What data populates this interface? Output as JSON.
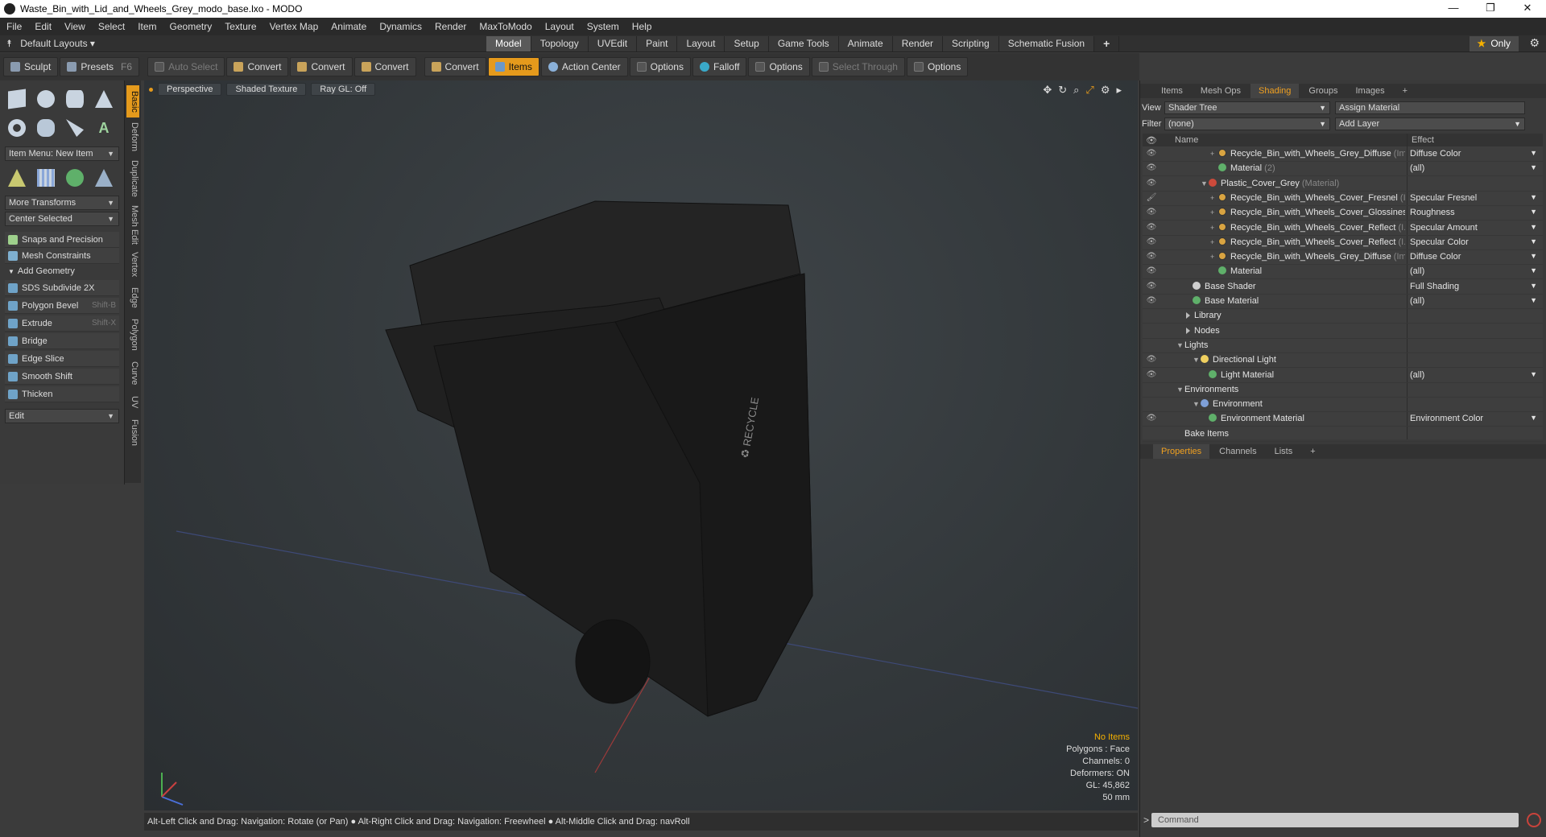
{
  "window": {
    "title": "Waste_Bin_with_Lid_and_Wheels_Grey_modo_base.lxo - MODO",
    "minimize": "—",
    "maximize": "❐",
    "close": "✕"
  },
  "menu": [
    "File",
    "Edit",
    "View",
    "Select",
    "Item",
    "Geometry",
    "Texture",
    "Vertex Map",
    "Animate",
    "Dynamics",
    "Render",
    "MaxToModo",
    "Layout",
    "System",
    "Help"
  ],
  "layout_bar": {
    "default_layouts": "Default Layouts",
    "tabs": [
      "Model",
      "Topology",
      "UVEdit",
      "Paint",
      "Layout",
      "Setup",
      "Game Tools",
      "Animate",
      "Render",
      "Scripting",
      "Schematic Fusion"
    ],
    "active_tab": "Model",
    "plus": "+",
    "only": "Only"
  },
  "toolbar": {
    "sculpt": "Sculpt",
    "presets": "Presets",
    "presets_key": "F6",
    "auto_select": "Auto Select",
    "convert1": "Convert",
    "convert2": "Convert",
    "convert3": "Convert",
    "convert4": "Convert",
    "items": "Items",
    "action_center": "Action Center",
    "options1": "Options",
    "falloff": "Falloff",
    "options2": "Options",
    "select_through": "Select Through",
    "options3": "Options"
  },
  "left_panel": {
    "item_menu": "Item Menu: New Item",
    "more_transforms": "More Transforms",
    "center_selected": "Center Selected",
    "snaps": "Snaps and Precision",
    "mesh_constraints": "Mesh Constraints",
    "add_geometry": "Add Geometry",
    "tools": [
      {
        "label": "SDS Subdivide 2X",
        "key": ""
      },
      {
        "label": "Polygon Bevel",
        "key": "Shift-B"
      },
      {
        "label": "Extrude",
        "key": "Shift-X"
      },
      {
        "label": "Bridge",
        "key": ""
      },
      {
        "label": "Edge Slice",
        "key": ""
      },
      {
        "label": "Smooth Shift",
        "key": ""
      },
      {
        "label": "Thicken",
        "key": ""
      }
    ],
    "edit_dropdown": "Edit",
    "side_tabs": [
      "Basic",
      "Deform",
      "Duplicate",
      "Mesh Edit",
      "Vertex",
      "Edge",
      "Polygon",
      "Curve",
      "UV",
      "Fusion"
    ]
  },
  "viewport": {
    "perspective": "Perspective",
    "shaded": "Shaded Texture",
    "raygl": "Ray GL: Off",
    "info": [
      "No Items",
      "Polygons : Face",
      "Channels: 0",
      "Deformers: ON",
      "GL: 45,862",
      "50 mm"
    ]
  },
  "status": "Alt-Left Click and Drag: Navigation: Rotate (or Pan) ● Alt-Right Click and Drag: Navigation: Freewheel ● Alt-Middle Click and Drag: navRoll",
  "right_panel": {
    "tabs": [
      "Items",
      "Mesh Ops",
      "Shading",
      "Groups",
      "Images",
      "+"
    ],
    "active_tab": "Shading",
    "view_label": "View",
    "view_value": "Shader Tree",
    "assign_material": "Assign Material",
    "filter_label": "Filter",
    "filter_value": "(none)",
    "add_layer": "Add Layer",
    "col_name": "Name",
    "col_effect": "Effect",
    "rows": [
      {
        "name": "Recycle_Bin_with_Wheels_Grey_Diffuse",
        "suffix": " (Im...",
        "effect": "Diffuse Color",
        "icon": "tex",
        "indent": 84,
        "eye": "👁",
        "exp": "+"
      },
      {
        "name": "Material",
        "suffix": " (2)",
        "effect": "(all)",
        "icon": "mat",
        "indent": 84,
        "eye": "👁",
        "exp": ""
      },
      {
        "name": "Plastic_Cover_Grey",
        "suffix": " (Material)",
        "effect": "",
        "icon": "matr",
        "indent": 72,
        "eye": "👁",
        "exp": "▼"
      },
      {
        "name": "Recycle_Bin_with_Wheels_Cover_Fresnel",
        "suffix": " (I...",
        "effect": "Specular Fresnel",
        "icon": "tex",
        "indent": 84,
        "eye": "🖌",
        "exp": "+"
      },
      {
        "name": "Recycle_Bin_with_Wheels_Cover_Glossines",
        "suffix": " ...",
        "effect": "Roughness",
        "icon": "tex",
        "indent": 84,
        "eye": "👁",
        "exp": "+"
      },
      {
        "name": "Recycle_Bin_with_Wheels_Cover_Reflect",
        "suffix": " (I...",
        "effect": "Specular Amount",
        "icon": "tex",
        "indent": 84,
        "eye": "👁",
        "exp": "+"
      },
      {
        "name": "Recycle_Bin_with_Wheels_Cover_Reflect",
        "suffix": " (I...",
        "effect": "Specular Color",
        "icon": "tex",
        "indent": 84,
        "eye": "👁",
        "exp": "+"
      },
      {
        "name": "Recycle_Bin_with_Wheels_Grey_Diffuse",
        "suffix": " (Im...",
        "effect": "Diffuse Color",
        "icon": "tex",
        "indent": 84,
        "eye": "👁",
        "exp": "+"
      },
      {
        "name": "Material",
        "suffix": "",
        "effect": "(all)",
        "icon": "mat",
        "indent": 84,
        "eye": "👁",
        "exp": ""
      },
      {
        "name": "Base Shader",
        "suffix": "",
        "effect": "Full Shading",
        "icon": "shd",
        "indent": 52,
        "eye": "👁",
        "exp": ""
      },
      {
        "name": "Base Material",
        "suffix": "",
        "effect": "(all)",
        "icon": "mat",
        "indent": 52,
        "eye": "👁",
        "exp": ""
      },
      {
        "name": "Library",
        "suffix": "",
        "effect": "",
        "icon": "fld",
        "indent": 44,
        "eye": "",
        "exp": ""
      },
      {
        "name": "Nodes",
        "suffix": "",
        "effect": "",
        "icon": "fld",
        "indent": 44,
        "eye": "",
        "exp": ""
      },
      {
        "name": "Lights",
        "suffix": "",
        "effect": "",
        "icon": "",
        "indent": 42,
        "eye": "",
        "exp": "▼"
      },
      {
        "name": "Directional Light",
        "suffix": "",
        "effect": "",
        "icon": "light",
        "indent": 62,
        "eye": "👁",
        "exp": "▼"
      },
      {
        "name": "Light Material",
        "suffix": "",
        "effect": "(all)",
        "icon": "mat",
        "indent": 72,
        "eye": "👁",
        "exp": ""
      },
      {
        "name": "Environments",
        "suffix": "",
        "effect": "",
        "icon": "",
        "indent": 42,
        "eye": "",
        "exp": "▼"
      },
      {
        "name": "Environment",
        "suffix": "",
        "effect": "",
        "icon": "env",
        "indent": 62,
        "eye": "",
        "exp": "▼"
      },
      {
        "name": "Environment Material",
        "suffix": "",
        "effect": "Environment Color",
        "icon": "mat",
        "indent": 72,
        "eye": "👁",
        "exp": ""
      },
      {
        "name": "Bake Items",
        "suffix": "",
        "effect": "",
        "icon": "",
        "indent": 42,
        "eye": "",
        "exp": ""
      }
    ],
    "prop_tabs": [
      "Properties",
      "Channels",
      "Lists",
      "+"
    ],
    "prop_active": "Properties",
    "command_placeholder": "Command",
    "command_prompt": ">"
  },
  "colors": {
    "accent": "#e59a1c",
    "active_tab_text": "#f0a020"
  }
}
